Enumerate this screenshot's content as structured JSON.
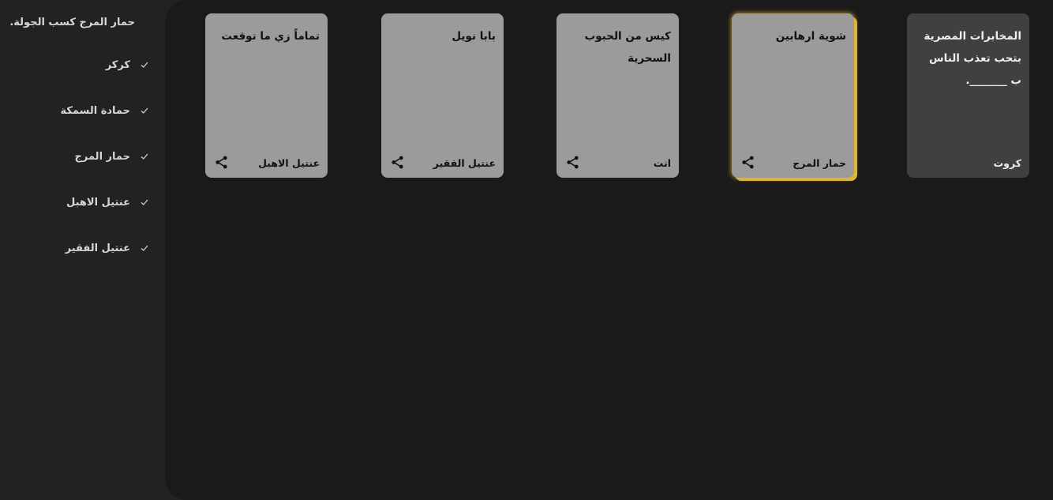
{
  "sidebar": {
    "winner_message": "حمار المرج كسب الجولة.",
    "players": [
      {
        "name": "كركر"
      },
      {
        "name": "حمادة السمكة"
      },
      {
        "name": "حمار المرج"
      },
      {
        "name": "عنتيل الاهبل"
      },
      {
        "name": "عنتيل الفقير"
      }
    ]
  },
  "black_card": {
    "text": "المخابرات المصرية بتحب تعذب الناس ب _______.",
    "owner": "كروت"
  },
  "white_cards": [
    {
      "text": "شوية ارهابين",
      "owner": "حمار المرج",
      "selected": true
    },
    {
      "text": "كيس من الحبوب السحرية",
      "owner": "انت",
      "selected": false
    },
    {
      "text": "بابا نويل",
      "owner": "عنتيل الفقير",
      "selected": false
    },
    {
      "text": "تماماً زي ما توقعت",
      "owner": "عنتيل الاهبل",
      "selected": false
    }
  ],
  "colors": {
    "sidebar_bg": "#232122",
    "board_bg": "#1a1a1a",
    "white_card": "#9b9b9b",
    "black_card": "#404040",
    "winner_highlight": "#e2b42b"
  },
  "icons": {
    "check": "check-icon",
    "share": "share-icon"
  }
}
